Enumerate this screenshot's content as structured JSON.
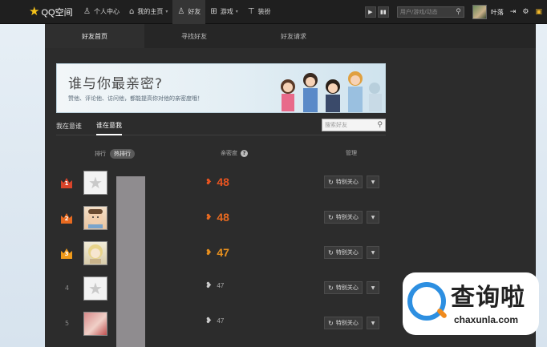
{
  "topbar": {
    "logo_text": "QQ空间",
    "nav": [
      {
        "label": "个人中心",
        "icon": "person-icon"
      },
      {
        "label": "我的主页",
        "icon": "home-icon"
      },
      {
        "label": "好友",
        "icon": "friends-icon",
        "active": true
      },
      {
        "label": "游戏",
        "icon": "grid-icon"
      },
      {
        "label": "装扮",
        "icon": "shirt-icon"
      }
    ],
    "search_placeholder": "用户/游戏/动态",
    "username": "叶落"
  },
  "tabs": [
    "好友首页",
    "寻找好友",
    "好友请求"
  ],
  "banner": {
    "title": "谁与你最亲密?",
    "subtitle": "赞他、评论他、访问他，都能提高你对他的亲密度哦！"
  },
  "sub_tabs": [
    "我在意谁",
    "谁在意我"
  ],
  "friend_search_placeholder": "搜索好友",
  "columns": {
    "rank": "排行",
    "hot_rank": "热排行",
    "intimacy": "亲密度",
    "manage": "管理"
  },
  "rows": [
    {
      "rank": "1",
      "score": "48",
      "color": "#e85420",
      "crown": "#d9442a"
    },
    {
      "rank": "2",
      "score": "48",
      "color": "#e86a20",
      "crown": "#e86a20"
    },
    {
      "rank": "3",
      "score": "47",
      "color": "#e8901e",
      "crown": "#ef9a1a"
    },
    {
      "rank": "4",
      "score": "47"
    },
    {
      "rank": "5",
      "score": "47"
    }
  ],
  "care_label": "特别关心",
  "watermark": {
    "cn": "查询啦",
    "en": "chaxunla.com"
  }
}
